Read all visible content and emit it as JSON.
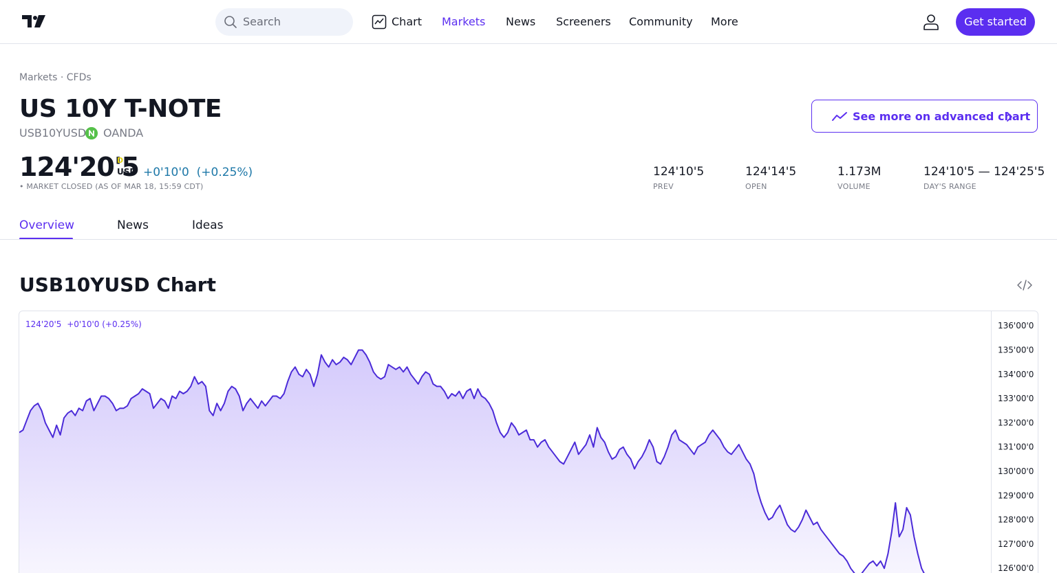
{
  "header": {
    "search_placeholder": "Search",
    "nav": [
      "Chart",
      "Markets",
      "News",
      "Screeners",
      "Community",
      "More"
    ],
    "active_nav": "Markets",
    "cta_label": "Get started"
  },
  "symbol": {
    "breadcrumb": "Markets · CFDs",
    "title": "US 10Y T-NOTE",
    "ticker": "USB10YUSD",
    "exchange": "OANDA",
    "advanced_chart_label": "See more on advanced chart",
    "price": "124'20'5",
    "price_flag": "D",
    "currency": "USD",
    "change_abs": "+0'10'0",
    "change_pct": "(+0.25%)",
    "market_status": "• MARKET CLOSED (AS OF MAR 18, 15:59 CDT)",
    "stats": [
      {
        "value": "124'10'5",
        "label": "PREV"
      },
      {
        "value": "124'14'5",
        "label": "OPEN"
      },
      {
        "value": "1.173M",
        "label": "VOLUME"
      },
      {
        "value": "124'10'5 — 124'25'5",
        "label": "DAY'S RANGE"
      }
    ]
  },
  "tabs": [
    "Overview",
    "News",
    "Ideas"
  ],
  "active_tab": "Overview",
  "chart_section": {
    "title": "USB10YUSD Chart",
    "legend_price": "124'20'5",
    "legend_change": "+0'10'0 (+0.25%)"
  },
  "colors": {
    "accent": "#5b2ef0",
    "line": "#4b2bd8",
    "change": "#1e78a8",
    "exchange_badge": "#56c14a"
  },
  "chart_data": {
    "type": "area",
    "y_tick_labels": [
      "136'00'0",
      "135'00'0",
      "134'00'0",
      "133'00'0",
      "132'00'0",
      "131'00'0",
      "130'00'0",
      "129'00'0",
      "128'00'0",
      "127'00'0",
      "126'00'0"
    ],
    "ylim": [
      125.6,
      136.6
    ],
    "grid": false,
    "values": [
      131.6,
      131.7,
      132.1,
      132.5,
      132.7,
      132.8,
      132.5,
      132.0,
      131.7,
      131.4,
      131.9,
      131.5,
      132.2,
      132.4,
      132.5,
      132.3,
      132.6,
      132.5,
      132.9,
      133.0,
      132.5,
      132.8,
      133.1,
      133.1,
      133.0,
      132.8,
      132.5,
      132.6,
      132.6,
      132.7,
      133.0,
      133.1,
      133.2,
      133.4,
      133.3,
      133.2,
      132.6,
      132.8,
      133.0,
      132.9,
      132.6,
      133.1,
      133.0,
      133.3,
      133.2,
      133.3,
      133.5,
      133.9,
      133.6,
      133.7,
      133.5,
      132.5,
      132.3,
      132.8,
      132.5,
      132.8,
      133.3,
      133.5,
      133.4,
      133.1,
      132.5,
      132.8,
      133.0,
      132.8,
      132.6,
      132.9,
      132.7,
      132.9,
      133.1,
      133.1,
      133.0,
      133.2,
      133.7,
      134.1,
      134.3,
      134.0,
      133.9,
      134.2,
      134.0,
      133.5,
      134.0,
      134.8,
      134.5,
      134.3,
      134.6,
      134.4,
      134.5,
      134.7,
      134.6,
      134.4,
      134.7,
      135.0,
      135.0,
      134.8,
      134.5,
      134.1,
      133.9,
      133.8,
      133.9,
      134.4,
      134.3,
      134.2,
      134.3,
      134.1,
      134.3,
      134.0,
      133.8,
      133.6,
      133.9,
      134.1,
      134.0,
      133.6,
      133.5,
      133.5,
      133.3,
      133.0,
      133.2,
      133.1,
      133.3,
      133.0,
      133.3,
      133.4,
      133.0,
      133.4,
      133.1,
      133.0,
      132.8,
      132.5,
      132.0,
      131.6,
      131.4,
      131.6,
      132.0,
      131.8,
      131.5,
      131.6,
      131.7,
      131.3,
      131.3,
      131.0,
      131.2,
      131.3,
      131.0,
      130.8,
      130.6,
      130.4,
      130.3,
      130.6,
      130.9,
      131.2,
      130.7,
      130.9,
      131.1,
      131.5,
      131.0,
      131.8,
      131.4,
      131.2,
      130.8,
      130.5,
      130.6,
      130.9,
      131.0,
      130.7,
      130.5,
      130.1,
      130.4,
      130.6,
      130.9,
      131.3,
      131.0,
      130.4,
      130.3,
      130.6,
      131.0,
      131.5,
      131.7,
      131.3,
      131.2,
      131.1,
      130.9,
      130.7,
      131.0,
      131.1,
      131.2,
      131.5,
      131.7,
      131.5,
      131.3,
      131.0,
      130.8,
      130.7,
      130.9,
      131.1,
      130.8,
      130.5,
      130.3,
      129.9,
      129.2,
      128.7,
      128.3,
      128.0,
      128.1,
      128.4,
      128.6,
      128.2,
      127.8,
      127.6,
      127.5,
      127.7,
      128.0,
      128.4,
      128.1,
      127.8,
      127.9,
      127.6,
      127.4,
      127.2,
      127.0,
      126.8,
      126.6,
      126.5,
      126.3,
      126.0,
      125.8,
      125.6,
      125.8,
      126.0,
      126.2,
      126.3,
      126.1,
      126.3,
      126.0,
      126.6,
      127.5,
      128.7,
      127.3,
      127.6,
      128.5,
      128.2,
      127.3,
      126.6,
      126.0,
      125.7,
      125.6
    ]
  }
}
